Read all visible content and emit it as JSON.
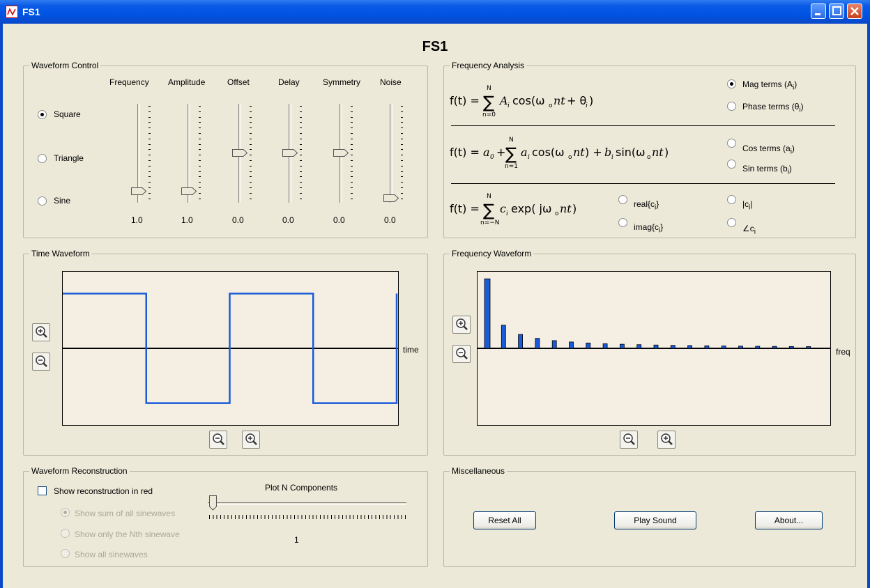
{
  "window": {
    "title": "FS1"
  },
  "app_title": "FS1",
  "waveform_control": {
    "legend": "Waveform Control",
    "slider_labels": [
      "Frequency",
      "Amplitude",
      "Offset",
      "Delay",
      "Symmetry",
      "Noise"
    ],
    "slider_values": [
      "1.0",
      "1.0",
      "0.0",
      "0.0",
      "0.0",
      "0.0"
    ],
    "slider_levels": [
      0.08,
      0.08,
      0.5,
      0.5,
      0.5,
      0.0
    ],
    "waveform_options": [
      "Square",
      "Triangle",
      "Sine"
    ],
    "selected_waveform": "Square"
  },
  "frequency_analysis": {
    "legend": "Frequency Analysis",
    "options": {
      "mag_terms": "Mag terms (A",
      "mag_sub": "i",
      "phase_terms": "Phase terms (θ",
      "phase_sub": "i",
      "cos_terms": "Cos terms (a",
      "cos_sub": "i",
      "sin_terms": "Sin terms (b",
      "sin_sub": "i",
      "real": "real{c",
      "real_sub": "i",
      "imag": "imag{c",
      "imag_sub": "i",
      "abs": "|c",
      "abs_sub": "i",
      "angle": "∠c",
      "angle_sub": "i"
    },
    "selected": "mag_terms"
  },
  "time_waveform": {
    "legend": "Time Waveform",
    "axis_label": "time"
  },
  "frequency_waveform": {
    "legend": "Frequency Waveform",
    "axis_label": "freq"
  },
  "chart_data": [
    {
      "type": "line",
      "title": "Time Waveform",
      "xlabel": "time",
      "series": [
        {
          "values": [
            1,
            1,
            -1,
            -1,
            1,
            1,
            -1,
            -1,
            1
          ]
        }
      ],
      "x": [
        0,
        0.25,
        0.25,
        0.5,
        0.5,
        0.75,
        0.75,
        1.0,
        1.0
      ],
      "ylim": [
        -1.4,
        1.4
      ],
      "grid": false
    },
    {
      "type": "bar",
      "title": "Frequency Waveform",
      "xlabel": "freq",
      "values": [
        1.27,
        0.424,
        0.255,
        0.182,
        0.141,
        0.116,
        0.098,
        0.085,
        0.075,
        0.067,
        0.061,
        0.055,
        0.051,
        0.047,
        0.044,
        0.041,
        0.038,
        0.036,
        0.034,
        0.032
      ],
      "ylim": [
        -1.4,
        1.4
      ],
      "grid": false
    }
  ],
  "reconstruction": {
    "legend": "Waveform Reconstruction",
    "show_reconstruction": "Show reconstruction in red",
    "options": [
      "Show sum of all sinewaves",
      "Show only the Nth sinewave",
      "Show all sinewaves"
    ],
    "plot_n_label": "Plot N Components",
    "n_value": "1"
  },
  "misc": {
    "legend": "Miscellaneous",
    "reset": "Reset All",
    "play": "Play Sound",
    "about": "About..."
  }
}
